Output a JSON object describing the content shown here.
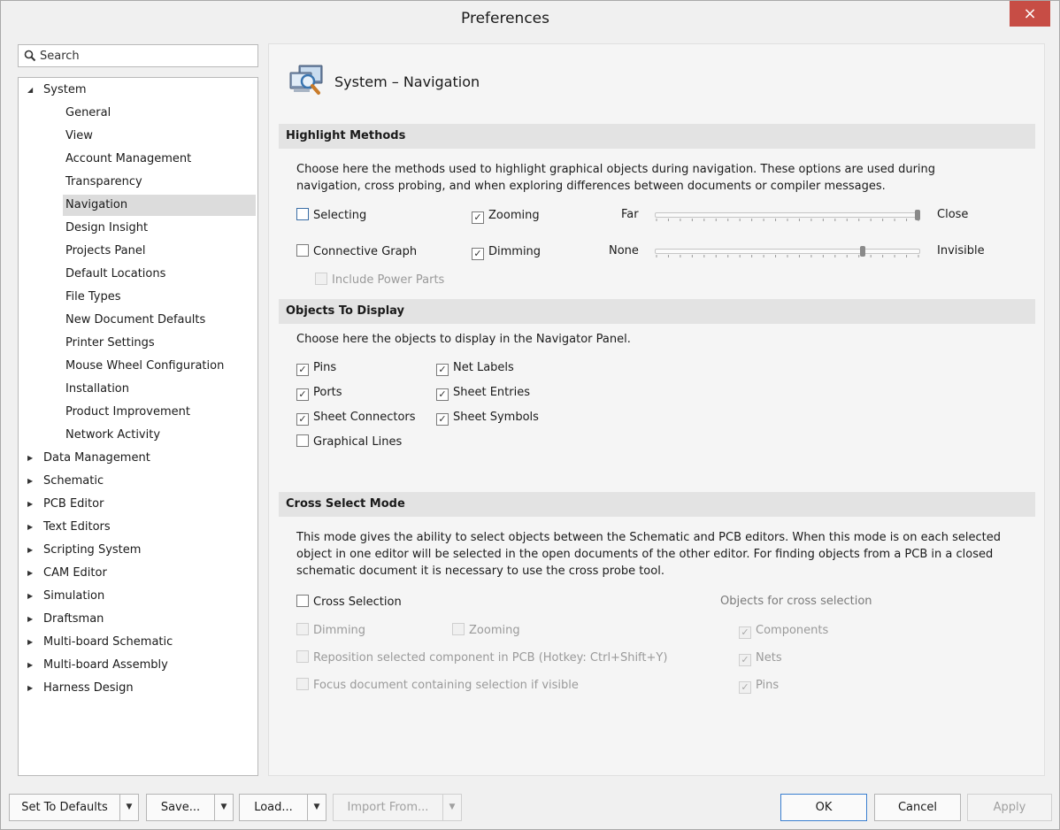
{
  "window": {
    "title": "Preferences",
    "close_icon": "×"
  },
  "search": {
    "placeholder": "Search"
  },
  "tree": {
    "system_label": "System",
    "system_children": [
      "General",
      "View",
      "Account Management",
      "Transparency",
      "Navigation",
      "Design Insight",
      "Projects Panel",
      "Default Locations",
      "File Types",
      "New Document Defaults",
      "Printer Settings",
      "Mouse Wheel Configuration",
      "Installation",
      "Product Improvement",
      "Network Activity"
    ],
    "selected": "Navigation",
    "top_items": [
      "Data Management",
      "Schematic",
      "PCB Editor",
      "Text Editors",
      "Scripting System",
      "CAM Editor",
      "Simulation",
      "Draftsman",
      "Multi-board Schematic",
      "Multi-board Assembly",
      "Harness Design"
    ]
  },
  "page": {
    "title": "System – Navigation"
  },
  "highlight": {
    "header": "Highlight Methods",
    "description": "Choose here the methods used to highlight graphical objects during navigation. These options are used during navigation, cross probing, and when exploring differences between documents or compiler messages.",
    "selecting": {
      "label": "Selecting",
      "checked": false
    },
    "zooming": {
      "label": "Zooming",
      "checked": true
    },
    "connective_graph": {
      "label": "Connective Graph",
      "checked": false
    },
    "dimming": {
      "label": "Dimming",
      "checked": true
    },
    "include_power_parts": {
      "label": "Include Power Parts",
      "checked": false,
      "disabled": true
    },
    "zoom_slider": {
      "min_label": "Far",
      "max_label": "Close",
      "value": 1.0
    },
    "dim_slider": {
      "min_label": "None",
      "max_label": "Invisible",
      "value": 0.79
    }
  },
  "objects": {
    "header": "Objects To Display",
    "description": "Choose here the objects to display in the Navigator Panel.",
    "pins": {
      "label": "Pins",
      "checked": true
    },
    "net_labels": {
      "label": "Net Labels",
      "checked": true
    },
    "ports": {
      "label": "Ports",
      "checked": true
    },
    "sheet_entries": {
      "label": "Sheet Entries",
      "checked": true
    },
    "sheet_connectors": {
      "label": "Sheet Connectors",
      "checked": true
    },
    "sheet_symbols": {
      "label": "Sheet Symbols",
      "checked": true
    },
    "graphical_lines": {
      "label": "Graphical Lines",
      "checked": false
    }
  },
  "cross_select": {
    "header": "Cross Select Mode",
    "description_lines": [
      "This mode gives the ability to select objects between the Schematic and PCB editors.  When this mode is on each selected",
      "object in one editor will be selected in the open documents of the other editor.  For finding objects from a PCB in a closed",
      "schematic document it is necessary to use the cross probe tool."
    ],
    "cross_selection": {
      "label": "Cross Selection",
      "checked": false
    },
    "objects_label": "Objects for cross selection",
    "dimming": {
      "label": "Dimming",
      "checked": false
    },
    "zooming": {
      "label": "Zooming",
      "checked": false
    },
    "reposition": {
      "label": "Reposition selected component in PCB (Hotkey: Ctrl+Shift+Y)",
      "checked": false
    },
    "focus": {
      "label": "Focus document containing selection if visible",
      "checked": false
    },
    "components": {
      "label": "Components",
      "checked": true
    },
    "nets": {
      "label": "Nets",
      "checked": true
    },
    "pins": {
      "label": "Pins",
      "checked": true
    }
  },
  "buttons": {
    "set_defaults": "Set To Defaults",
    "save": "Save...",
    "load": "Load...",
    "import_from": "Import From...",
    "ok": "OK",
    "cancel": "Cancel",
    "apply": "Apply",
    "dropdown_arrow": "▼"
  },
  "check_glyph": "✓",
  "tree_glyphs": {
    "expanded": "◢",
    "collapsed": "▶"
  }
}
